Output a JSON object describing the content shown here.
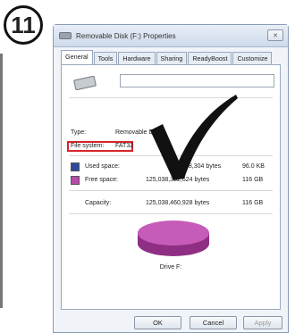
{
  "step_number": "11",
  "window": {
    "title": "Removable Disk (F:) Properties",
    "close_glyph": "✕"
  },
  "tabs": [
    "General",
    "Tools",
    "Hardware",
    "Sharing",
    "ReadyBoost",
    "Customize"
  ],
  "general": {
    "type_label": "Type:",
    "type_value": "Removable Disk",
    "fs_label": "File system:",
    "fs_value": "FAT32",
    "used_label": "Used space:",
    "used_bytes": "98,304 bytes",
    "used_size": "96.0 KB",
    "free_label": "Free space:",
    "free_bytes": "125,038,362,624 bytes",
    "free_size": "116 GB",
    "capacity_label": "Capacity:",
    "capacity_bytes": "125,038,460,928 bytes",
    "capacity_size": "116 GB",
    "drive_label": "Drive F:"
  },
  "colors": {
    "used": "#2a4a9c",
    "free": "#b84aa8",
    "highlight": "#d6252a"
  },
  "buttons": {
    "ok": "OK",
    "cancel": "Cancel",
    "apply": "Apply"
  },
  "icons": {
    "drive": "removable-drive-icon",
    "check": "checkmark-icon"
  }
}
